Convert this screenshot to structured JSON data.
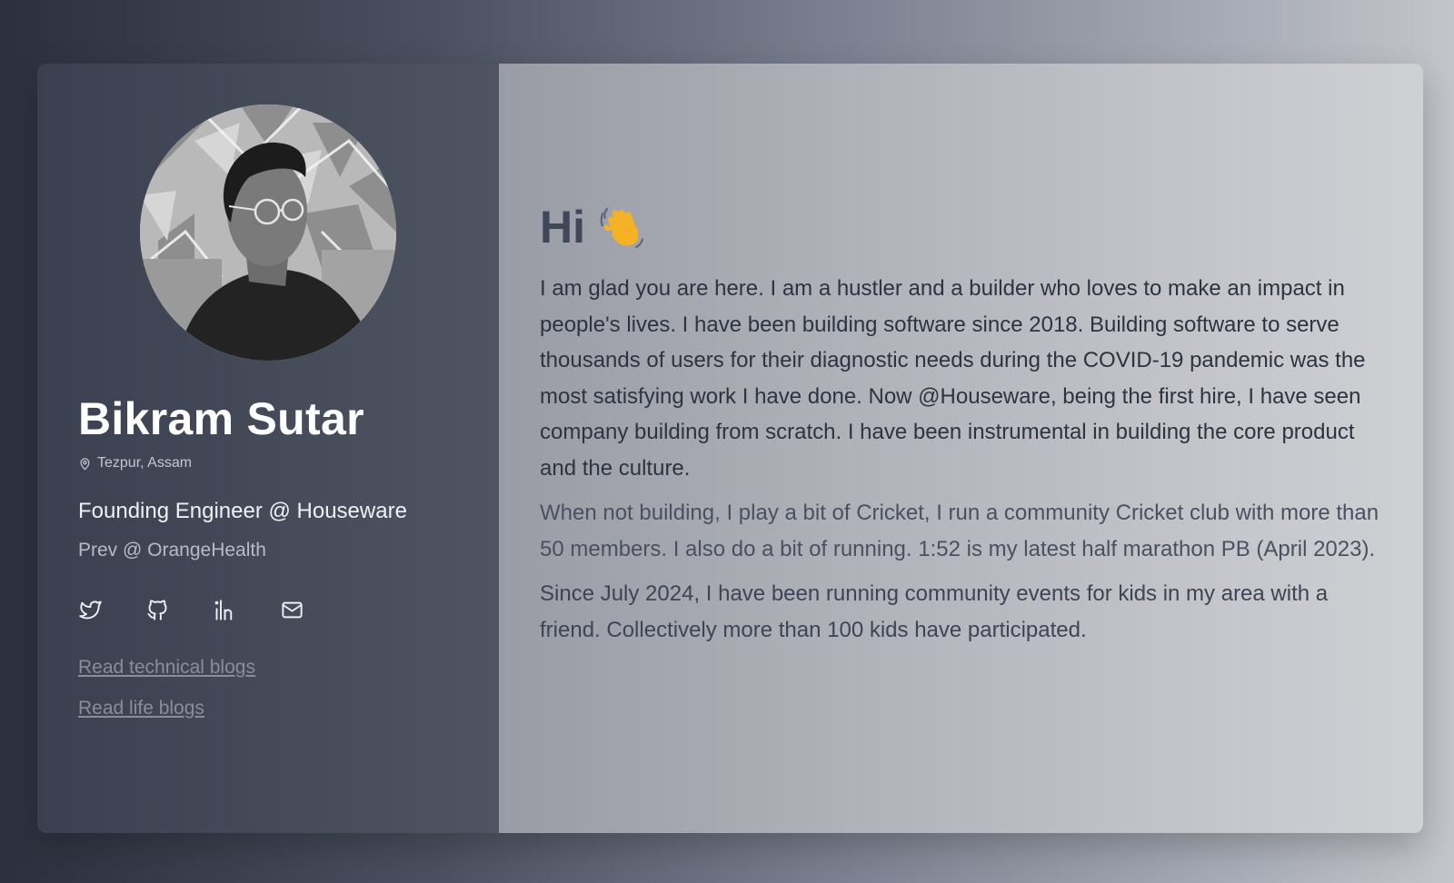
{
  "profile": {
    "name": "Bikram Sutar",
    "location": "Tezpur, Assam",
    "role": "Founding Engineer @ Houseware",
    "previous": "Prev @ OrangeHealth",
    "socials": [
      {
        "id": "twitter",
        "icon": "twitter-icon"
      },
      {
        "id": "github",
        "icon": "github-icon"
      },
      {
        "id": "linkedin",
        "icon": "linkedin-icon"
      },
      {
        "id": "email",
        "icon": "mail-icon"
      }
    ],
    "links": {
      "technical_blogs": "Read technical blogs",
      "life_blogs": "Read life blogs"
    }
  },
  "about": {
    "greeting": "Hi",
    "greeting_emoji": "👋",
    "paragraphs": [
      "I am glad you are here. I am a hustler and a builder who loves to make an impact in people's lives. I have been building software since 2018. Building software to serve thousands of users for their diagnostic needs during the COVID-19 pandemic was the most satisfying work I have done. Now @Houseware, being the first hire, I have seen company building from scratch. I have been instrumental in building the core product and the culture.",
      "When not building, I play a bit of Cricket, I run a community Cricket club with more than 50 members. I also do a bit of running. 1:52 is my latest half marathon PB (April 2023).",
      "Since July 2024, I have been running community events for kids in my area with a friend. Collectively more than 100 kids have participated."
    ]
  },
  "colors": {
    "sidebar_bg": "#474c5b",
    "content_bg": "#c1c2c8",
    "heading": "#3f4758",
    "name": "#ffffff",
    "link": "#8a8e99"
  }
}
